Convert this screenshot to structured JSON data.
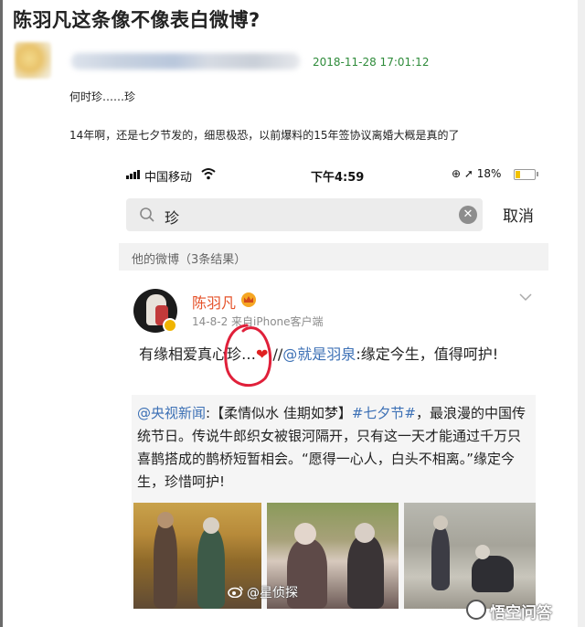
{
  "article": {
    "headline": "陈羽凡这条像不像表白微博?",
    "timestamp": "2018-11-28 17:01:12",
    "line1": "何时珍……珍",
    "line2": "14年啊，还是七夕节发的，细思极恐，以前爆料的15年签协议离婚大概是真的了"
  },
  "phone": {
    "status": {
      "carrier": "中国移动",
      "time": "下午4:59",
      "battery": "18%"
    },
    "search": {
      "value": "珍",
      "cancel": "取消"
    },
    "section_label": "他的微博（3条结果）",
    "post": {
      "author": "陈羽凡",
      "date": "14-8-2",
      "source": "来自iPhone客户端",
      "text_part1": "有缘相爱真心珍…",
      "text_part2": " //",
      "mention": "@就是羽泉",
      "text_part3": ":缘定今生，值得呵护!",
      "repost": {
        "mention": "@央视新闻",
        "colon": ":",
        "tag_topic": "【柔情似水 佳期如梦】",
        "hashtag": "#七夕节#",
        "body": "，最浪漫的中国传统节日。传说牛郎织女被银河隔开，只有这一天才能通过千万只喜鹊搭成的鹊桥短暂相会。“愿得一心人，白头不相离。”缘定今生，珍惜呵护!"
      }
    }
  },
  "watermarks": {
    "weibo": "@星侦探",
    "brand": "悟空问答"
  },
  "colors": {
    "timestamp_green": "#2e8b3a",
    "author_orange": "#e5522a",
    "link_blue": "#3c70b5",
    "heart_red": "#e02020",
    "annotation_red": "#e0203a"
  }
}
